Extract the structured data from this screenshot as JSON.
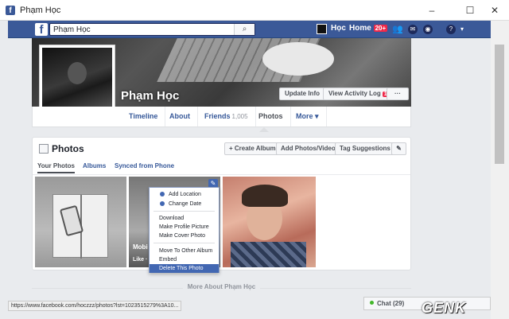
{
  "window": {
    "title": "Phạm Học",
    "controls": {
      "minimize": "–",
      "maximize": "☐",
      "close": "✕"
    }
  },
  "topbar": {
    "search_value": "Phạm Học",
    "search_icon": "search-icon",
    "profile_name": "Học",
    "home_label": "Home",
    "home_badge": "20+",
    "help_symbol": "?",
    "icons": [
      "friends-icon",
      "messages-icon",
      "globe-icon",
      "help-icon",
      "dropdown-icon"
    ]
  },
  "profile": {
    "name": "Phạm Học",
    "update_info": "Update Info",
    "view_activity_log": "View Activity Log",
    "activity_badge": "10+",
    "more_symbol": "···"
  },
  "tabs": [
    {
      "label": "Timeline"
    },
    {
      "label": "About"
    },
    {
      "label": "Friends",
      "count": "1,005"
    },
    {
      "label": "Photos"
    },
    {
      "label": "More ▾"
    }
  ],
  "photos": {
    "heading": "Photos",
    "create_album": "+ Create Album",
    "add_photos": "Add Photos/Video",
    "tag_suggestions": "Tag Suggestions",
    "edit_symbol": "✎",
    "subtabs": [
      "Your Photos",
      "Albums",
      "Synced from Phone"
    ],
    "tile2_caption": "Mobi",
    "tile2_caption_line2": "Like · C"
  },
  "context_menu": {
    "items": [
      "Add Location",
      "Change Date",
      "Download",
      "Make Profile Picture",
      "Make Cover Photo",
      "Move To Other Album",
      "Embed",
      "Delete This Photo"
    ],
    "selected": "Delete This Photo"
  },
  "footer": {
    "more_about": "More About Phạm Học",
    "status_url": "https://www.facebook.com/hoczzz/photos?lst=1023515279%3A10...",
    "chat_label": "Chat (29)",
    "watermark": "GENK"
  },
  "colors": {
    "facebook_blue": "#3b5998",
    "accent": "#4267b2",
    "badge_red": "#f02849"
  }
}
